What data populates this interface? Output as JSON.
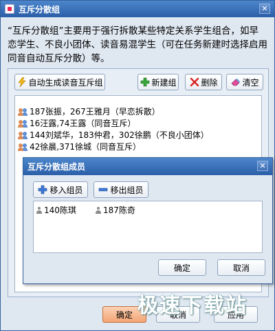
{
  "main_window": {
    "title": "互斥分散组",
    "description": "“互斥分散组”主要用于强行拆散某些特定关系学生组合，如早恋学生、不良小团体、读音易混学生（可在任务新建时选择启用同音自动互斥分散）等。",
    "toolbar": {
      "auto_generate_label": "自动生成读音互斥组",
      "new_group_label": "新建组",
      "delete_label": "删除",
      "clear_label": "清空"
    },
    "groups": [
      "187张振，267王雅月（早恋拆散）",
      "16汪露,74王露（同音互斥）",
      "144刘斌华，183仲君，302徐鹏（不良小团体）",
      "42徐晨,371徐城（同音互斥）"
    ],
    "bottom_buttons": {
      "ok_label": "确定",
      "cancel_label": "取消",
      "apply_label": "应用"
    }
  },
  "dialog": {
    "title": "互斥分散组成员",
    "add_member_label": "移入组员",
    "remove_member_label": "移出组员",
    "members": [
      "140陈琪",
      "187陈奇"
    ],
    "ok_label": "确定",
    "cancel_label": "取消"
  },
  "watermark": "极速下载站",
  "colors": {
    "titlebar": "#2b5fa8",
    "window_bg": "#dfe7f1",
    "ok_button": "#f6b48a"
  }
}
